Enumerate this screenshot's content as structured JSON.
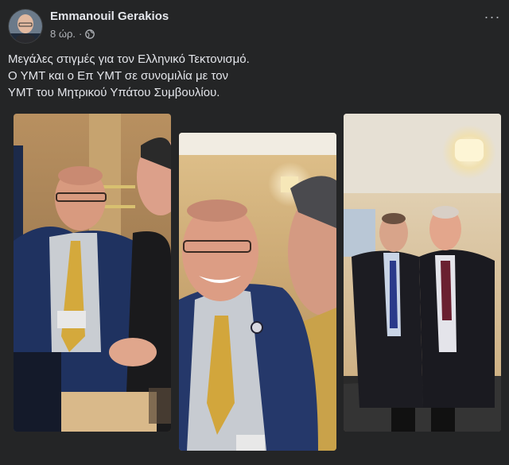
{
  "post": {
    "author": "Emmanouil Gerakios",
    "time": "8 ώρ.",
    "separator": "·",
    "privacy_icon": "globe-icon",
    "more_icon": "more-options-icon",
    "more_label": "···",
    "text_lines": [
      "Μεγάλες στιγμές για τον Ελληνικό Τεκτονισμό.",
      "Ο ΥΜΤ και ο Επ ΥΜΤ σε συνομιλία με τον",
      "ΥΜΤ του Μητρικού Υπάτου Συμβουλίου."
    ]
  },
  "photos": [
    "photo-1",
    "photo-2",
    "photo-3"
  ],
  "colors": {
    "background": "#242526",
    "text_primary": "#e4e6eb",
    "text_secondary": "#b0b3b8"
  }
}
